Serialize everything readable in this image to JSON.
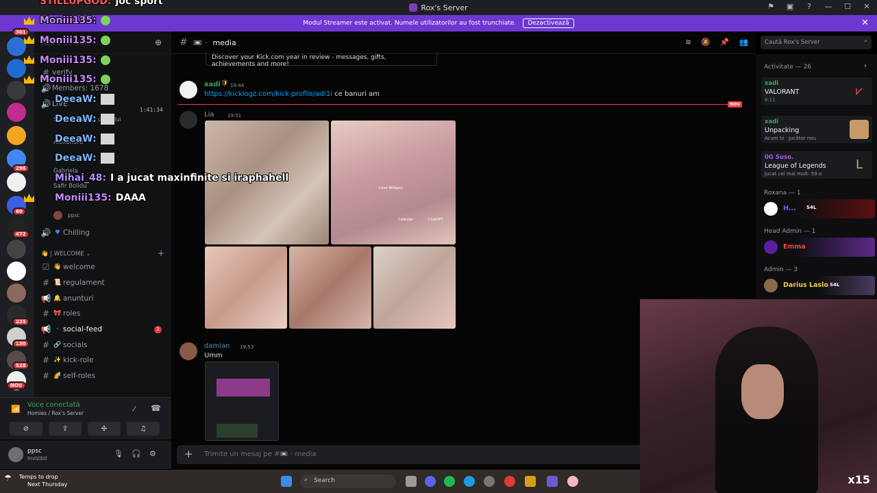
{
  "overlay_top": {
    "user": "STILLUPGOD:",
    "text": "joc sport"
  },
  "window": {
    "server_title": "Rox's Server"
  },
  "banner": {
    "text": "Modul Streamer este activat. Numele utilizatorilor au fost trunchiate.",
    "button": "Dezactivează"
  },
  "guild_badges": [
    "301",
    "472",
    "296",
    "225",
    "130",
    "528",
    "60",
    "NOU"
  ],
  "server": {
    "name": "Rox's Server"
  },
  "channels_top": [
    {
      "icon": "#",
      "label": "verify"
    },
    {
      "icon": "●",
      "label": "Members: 1678"
    },
    {
      "icon": "🔊",
      "label": "LIVE"
    }
  ],
  "voice_users": [
    {
      "name": "Setează statusul canalului",
      "time": "1:41:34"
    },
    {
      "name": "Alexandru"
    },
    {
      "name": "Gabriela"
    },
    {
      "name": "Safir Bolidu"
    },
    {
      "name": "ppsc"
    }
  ],
  "voice_channel_chilling": "Chilling",
  "welcome_category": "| WELCOME",
  "channels": [
    {
      "icon": "☑",
      "emoji": "👋",
      "label": "welcome"
    },
    {
      "icon": "#",
      "emoji": "📜",
      "label": "regulament"
    },
    {
      "icon": "📢",
      "emoji": "🔔",
      "label": "anunturi"
    },
    {
      "icon": "#",
      "emoji": "🎀",
      "label": "roles"
    },
    {
      "icon": "📢",
      "emoji": "·",
      "label": "social-feed",
      "badge": "2"
    },
    {
      "icon": "#",
      "emoji": "🔗",
      "label": "socials"
    },
    {
      "icon": "#",
      "emoji": "✨",
      "label": "kick-role"
    },
    {
      "icon": "#",
      "emoji": "🌈",
      "label": "self-roles"
    }
  ],
  "voice_panel": {
    "title": "Voce conectată",
    "subtitle": "Homies / Rox's Server"
  },
  "user_panel": {
    "name": "ppsc",
    "status": "Invizibil"
  },
  "channel_header": {
    "name": "media"
  },
  "search": {
    "placeholder": "Caută Rox's Server"
  },
  "promo": {
    "text": "Discover your Kick.com year in review - messages, gifts, achievements and more!"
  },
  "messages": [
    {
      "author": "xadi",
      "time": "19:44",
      "link": "https://kicklogz.com/kick-profile/adi1i",
      "text": "ce banuri am"
    },
    {
      "author": "Lia",
      "time": "19:51"
    },
    {
      "author": "damian",
      "time": "19:53",
      "text": "Umm"
    }
  ],
  "new_label": "NOU",
  "collage_labels": [
    "Color Widgets",
    "Calendar",
    "ChatGPT"
  ],
  "composer": {
    "placeholder": "Trimite un mesaj pe #📼 · media"
  },
  "activity": {
    "header": "Activitate — 26",
    "items": [
      {
        "name": "xadi",
        "game": "VALORANT",
        "sub": "8:11"
      },
      {
        "name": "xadi",
        "game": "Unpacking",
        "sub": "Acum tz · Jucător nou"
      },
      {
        "name": "0G Suso.",
        "game": "League of Legends",
        "sub": "Jucat cel mai mult: 59 o"
      }
    ]
  },
  "member_groups": [
    {
      "header": "Roxana — 1",
      "member": "H...",
      "tag": "S4L"
    },
    {
      "header": "Head Admin — 1",
      "member": "Emma"
    },
    {
      "header": "Admin — 3",
      "member": "Darius Laslo",
      "tag": "S4L"
    }
  ],
  "stream_overlay": [
    {
      "user": "Moniii135:",
      "text": ""
    },
    {
      "user": "Moniii135:",
      "text": ""
    },
    {
      "user": "Moniii135:",
      "text": ""
    },
    {
      "user": "Moniii135:",
      "text": ""
    },
    {
      "user": "DeeaW:",
      "text": ""
    },
    {
      "user": "DeeaW:",
      "text": ""
    },
    {
      "user": "DeeaW:",
      "text": ""
    },
    {
      "user": "DeeaW:",
      "text": ""
    },
    {
      "user": "Mihai_48:",
      "text": "I a jucat maxinfinite si iraphahell"
    },
    {
      "user": "Moniii135:",
      "text": "DAAA"
    }
  ],
  "taskbar": {
    "weather_1": "Temps to drop",
    "weather_2": "Next Thursday",
    "search": "Search"
  },
  "cam_counter": "x15",
  "colors": {
    "accent": "#6d38d1",
    "green": "#3ba55d",
    "red": "#da373c",
    "link": "#00a8fc"
  }
}
